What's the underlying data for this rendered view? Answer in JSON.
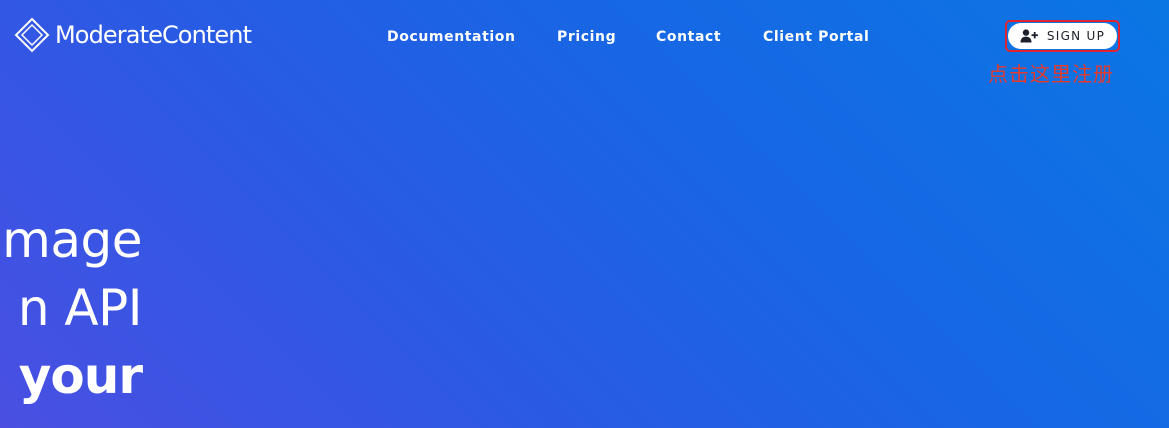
{
  "brand": {
    "name": "ModerateContent",
    "logo_icon": "diamond-outline-icon"
  },
  "nav": {
    "items": [
      {
        "label": "Documentation"
      },
      {
        "label": "Pricing"
      },
      {
        "label": "Contact"
      },
      {
        "label": "Client Portal"
      }
    ]
  },
  "signup": {
    "label": "SIGN UP",
    "icon": "user-plus-icon"
  },
  "annotation": {
    "text": "点击这里注册",
    "color": "#e53b2c"
  },
  "hero": {
    "line1": "mage",
    "line2": "n API",
    "line3": "your"
  },
  "colors": {
    "background_start": "#0a76e4",
    "background_end": "#4a4fe2",
    "highlight_border": "#e0242f"
  }
}
